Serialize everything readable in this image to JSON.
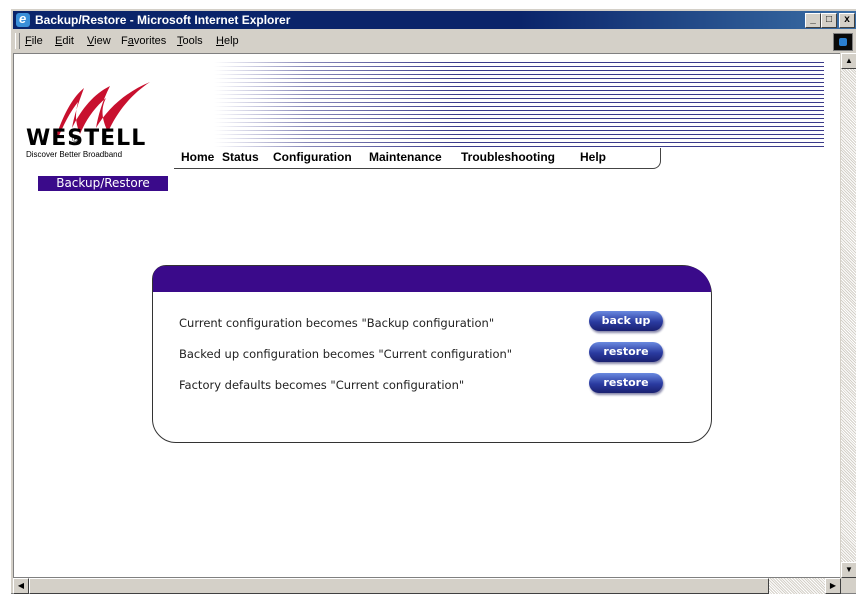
{
  "window": {
    "title": "Backup/Restore - Microsoft Internet Explorer",
    "min": "_",
    "max": "□",
    "close": "x"
  },
  "menu": [
    {
      "accel": "F",
      "rest": "ile"
    },
    {
      "accel": "E",
      "rest": "dit"
    },
    {
      "accel": "V",
      "rest": "iew"
    },
    {
      "pre": "F",
      "accel": "a",
      "rest": "vorites"
    },
    {
      "accel": "T",
      "rest": "ools"
    },
    {
      "accel": "H",
      "rest": "elp"
    }
  ],
  "brand": {
    "name": "WESTELL",
    "tagline": "Discover Better Broadband",
    "registered": "®"
  },
  "nav": [
    "Home",
    "Status",
    "Configuration",
    "Maintenance",
    "Troubleshooting",
    "Help"
  ],
  "section_title": "Backup/Restore",
  "rows": [
    {
      "text": "Current configuration becomes \"Backup configuration\"",
      "button": "back up"
    },
    {
      "text": "Backed up configuration becomes \"Current configuration\"",
      "button": "restore"
    },
    {
      "text": "Factory defaults becomes \"Current configuration\"",
      "button": "restore"
    }
  ],
  "colors": {
    "accent": "#3a0a8a",
    "titlebar": "#0a246a",
    "button": "#2a3aa0"
  }
}
